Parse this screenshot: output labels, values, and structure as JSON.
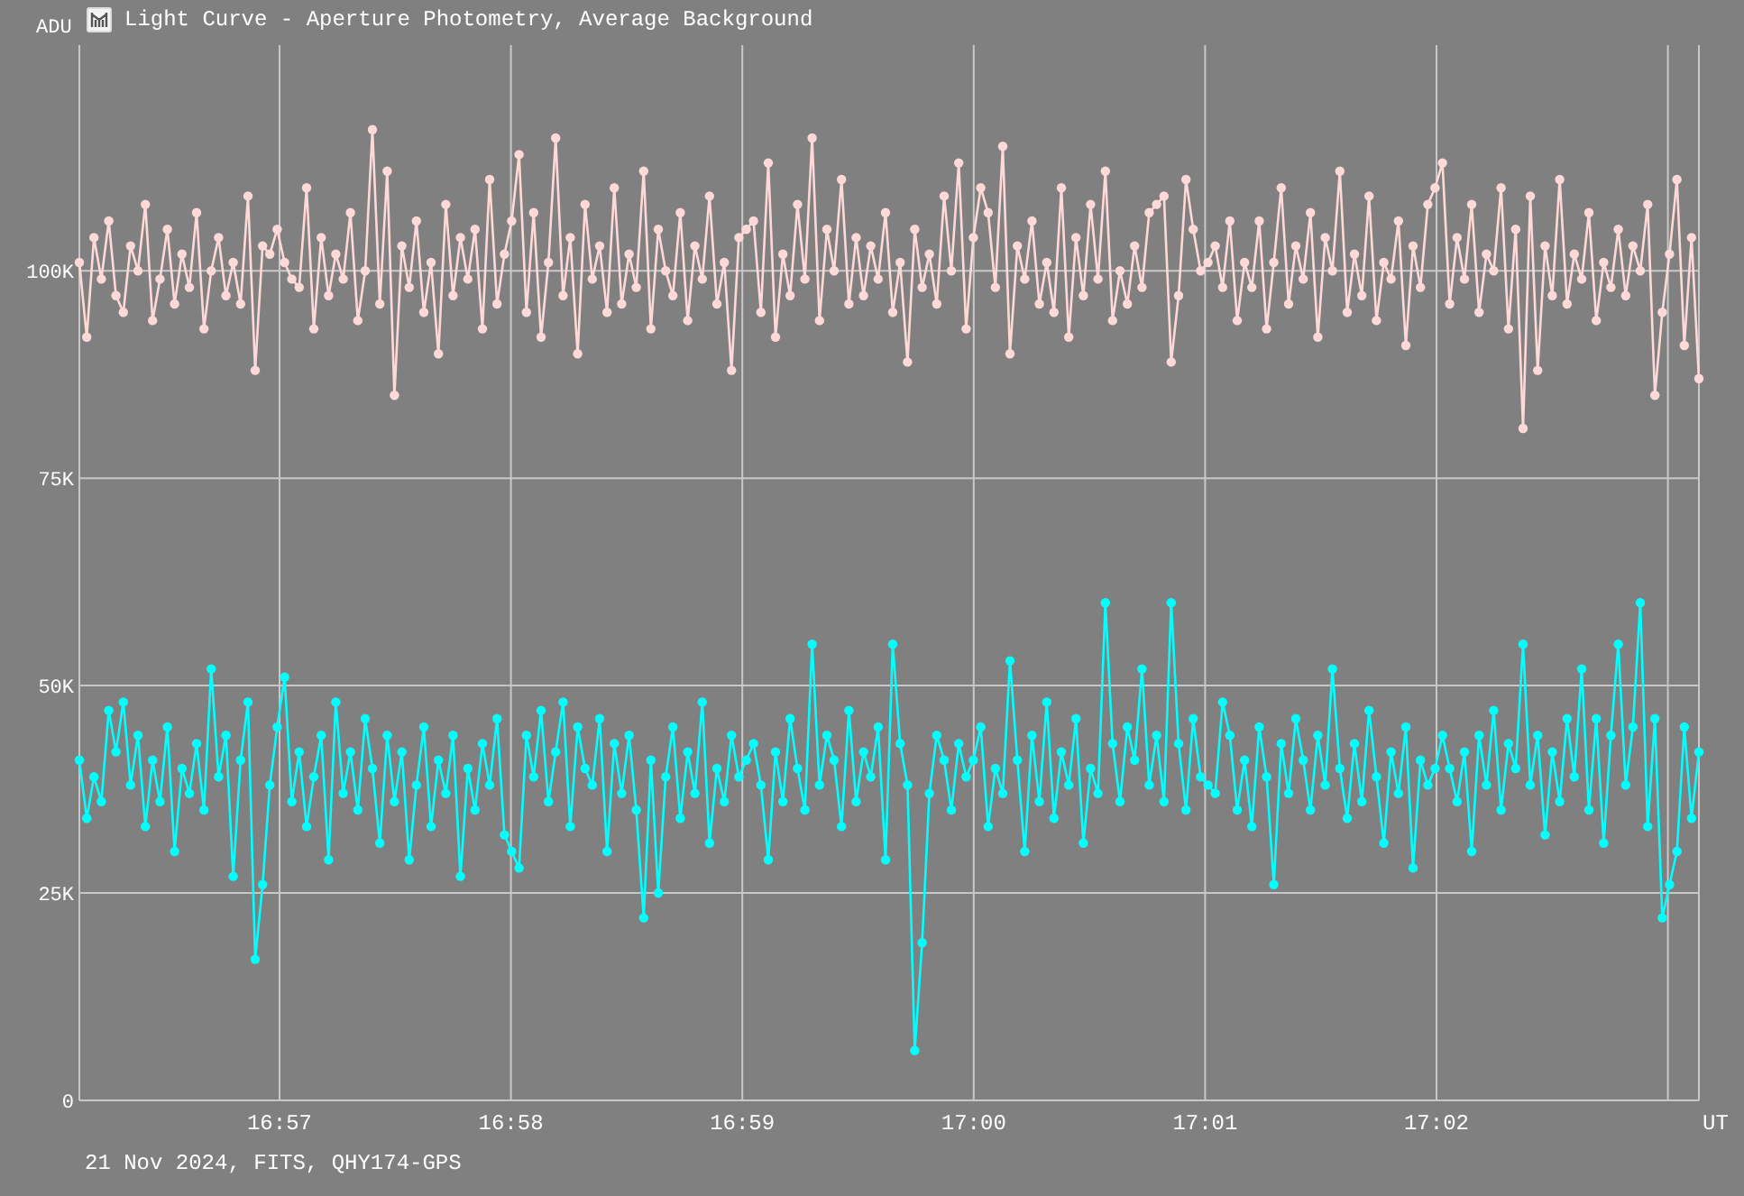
{
  "window": {
    "title": "Light Curve - Aperture Photometry, Average Background"
  },
  "chart": {
    "time_labels": [
      "16:57",
      "16:58",
      "16:59",
      "17:00",
      "17:01",
      "17:02"
    ],
    "chart_data": {
      "type": "line",
      "ylabel": "ADU",
      "xlabel": "UT",
      "ylim": [
        0,
        127.2
      ],
      "grid": true,
      "yticks": [
        {
          "value": 0,
          "label": "0"
        },
        {
          "value": 25,
          "label": "25K"
        },
        {
          "value": 50,
          "label": "50K"
        },
        {
          "value": 75,
          "label": "75K"
        },
        {
          "value": 100,
          "label": "100K"
        }
      ],
      "series": [
        {
          "color": "#ffd8d8",
          "values": [
            101,
            92,
            104,
            99,
            106,
            97,
            95,
            103,
            100,
            108,
            94,
            99,
            105,
            96,
            102,
            98,
            107,
            93,
            100,
            104,
            97,
            101,
            96,
            109,
            88,
            103,
            102,
            105,
            101,
            99,
            98,
            110,
            93,
            104,
            97,
            102,
            99,
            107,
            94,
            100,
            117,
            96,
            112,
            85,
            103,
            98,
            106,
            95,
            101,
            90,
            108,
            97,
            104,
            99,
            105,
            93,
            111,
            96,
            102,
            106,
            114,
            95,
            107,
            92,
            101,
            116,
            97,
            104,
            90,
            108,
            99,
            103,
            95,
            110,
            96,
            102,
            98,
            112,
            93,
            105,
            100,
            97,
            107,
            94,
            103,
            99,
            109,
            96,
            101,
            88,
            104,
            105,
            106,
            95,
            113,
            92,
            102,
            97,
            108,
            99,
            116,
            94,
            105,
            100,
            111,
            96,
            104,
            97,
            103,
            99,
            107,
            95,
            101,
            89,
            105,
            98,
            102,
            96,
            109,
            100,
            113,
            93,
            104,
            110,
            107,
            98,
            115,
            90,
            103,
            99,
            106,
            96,
            101,
            95,
            110,
            92,
            104,
            97,
            108,
            99,
            112,
            94,
            100,
            96,
            103,
            98,
            107,
            108,
            109,
            89,
            97,
            111,
            105,
            100,
            101,
            103,
            98,
            106,
            94,
            101,
            98,
            106,
            93,
            101,
            110,
            96,
            103,
            99,
            107,
            92,
            104,
            100,
            112,
            95,
            102,
            97,
            109,
            94,
            101,
            99,
            106,
            91,
            103,
            98,
            108,
            110,
            113,
            96,
            104,
            99,
            108,
            95,
            102,
            100,
            110,
            93,
            105,
            81,
            109,
            88,
            103,
            97,
            111,
            96,
            102,
            99,
            107,
            94,
            101,
            98,
            105,
            97,
            103,
            100,
            108,
            85,
            95,
            102,
            111,
            91,
            104,
            87
          ]
        },
        {
          "color": "#00ffff",
          "values": [
            41,
            34,
            39,
            36,
            47,
            42,
            48,
            38,
            44,
            33,
            41,
            36,
            45,
            30,
            40,
            37,
            43,
            35,
            52,
            39,
            44,
            27,
            41,
            48,
            17,
            26,
            38,
            45,
            51,
            36,
            42,
            33,
            39,
            44,
            29,
            48,
            37,
            42,
            35,
            46,
            40,
            31,
            44,
            36,
            42,
            29,
            38,
            45,
            33,
            41,
            37,
            44,
            27,
            40,
            35,
            43,
            38,
            46,
            32,
            30,
            28,
            44,
            39,
            47,
            36,
            42,
            48,
            33,
            45,
            40,
            38,
            46,
            30,
            43,
            37,
            44,
            35,
            22,
            41,
            25,
            39,
            45,
            34,
            42,
            37,
            48,
            31,
            40,
            36,
            44,
            39,
            41,
            43,
            38,
            29,
            42,
            36,
            46,
            40,
            35,
            55,
            38,
            44,
            41,
            33,
            47,
            36,
            42,
            39,
            45,
            29,
            55,
            43,
            38,
            6,
            19,
            37,
            44,
            41,
            35,
            43,
            39,
            41,
            45,
            33,
            40,
            37,
            53,
            41,
            30,
            44,
            36,
            48,
            34,
            42,
            38,
            46,
            31,
            40,
            37,
            60,
            43,
            36,
            45,
            41,
            52,
            38,
            44,
            36,
            60,
            43,
            35,
            46,
            39,
            38,
            37,
            48,
            44,
            35,
            41,
            33,
            45,
            39,
            26,
            43,
            37,
            46,
            41,
            35,
            44,
            38,
            52,
            40,
            34,
            43,
            36,
            47,
            39,
            31,
            42,
            37,
            45,
            28,
            41,
            38,
            40,
            44,
            40,
            36,
            42,
            30,
            44,
            38,
            47,
            35,
            43,
            40,
            55,
            38,
            44,
            32,
            42,
            36,
            46,
            39,
            52,
            35,
            46,
            31,
            44,
            55,
            38,
            45,
            60,
            33,
            46,
            22,
            26,
            30,
            45,
            34,
            42
          ]
        }
      ]
    }
  },
  "footer": {
    "text": "21 Nov 2024, FITS, QHY174-GPS"
  }
}
